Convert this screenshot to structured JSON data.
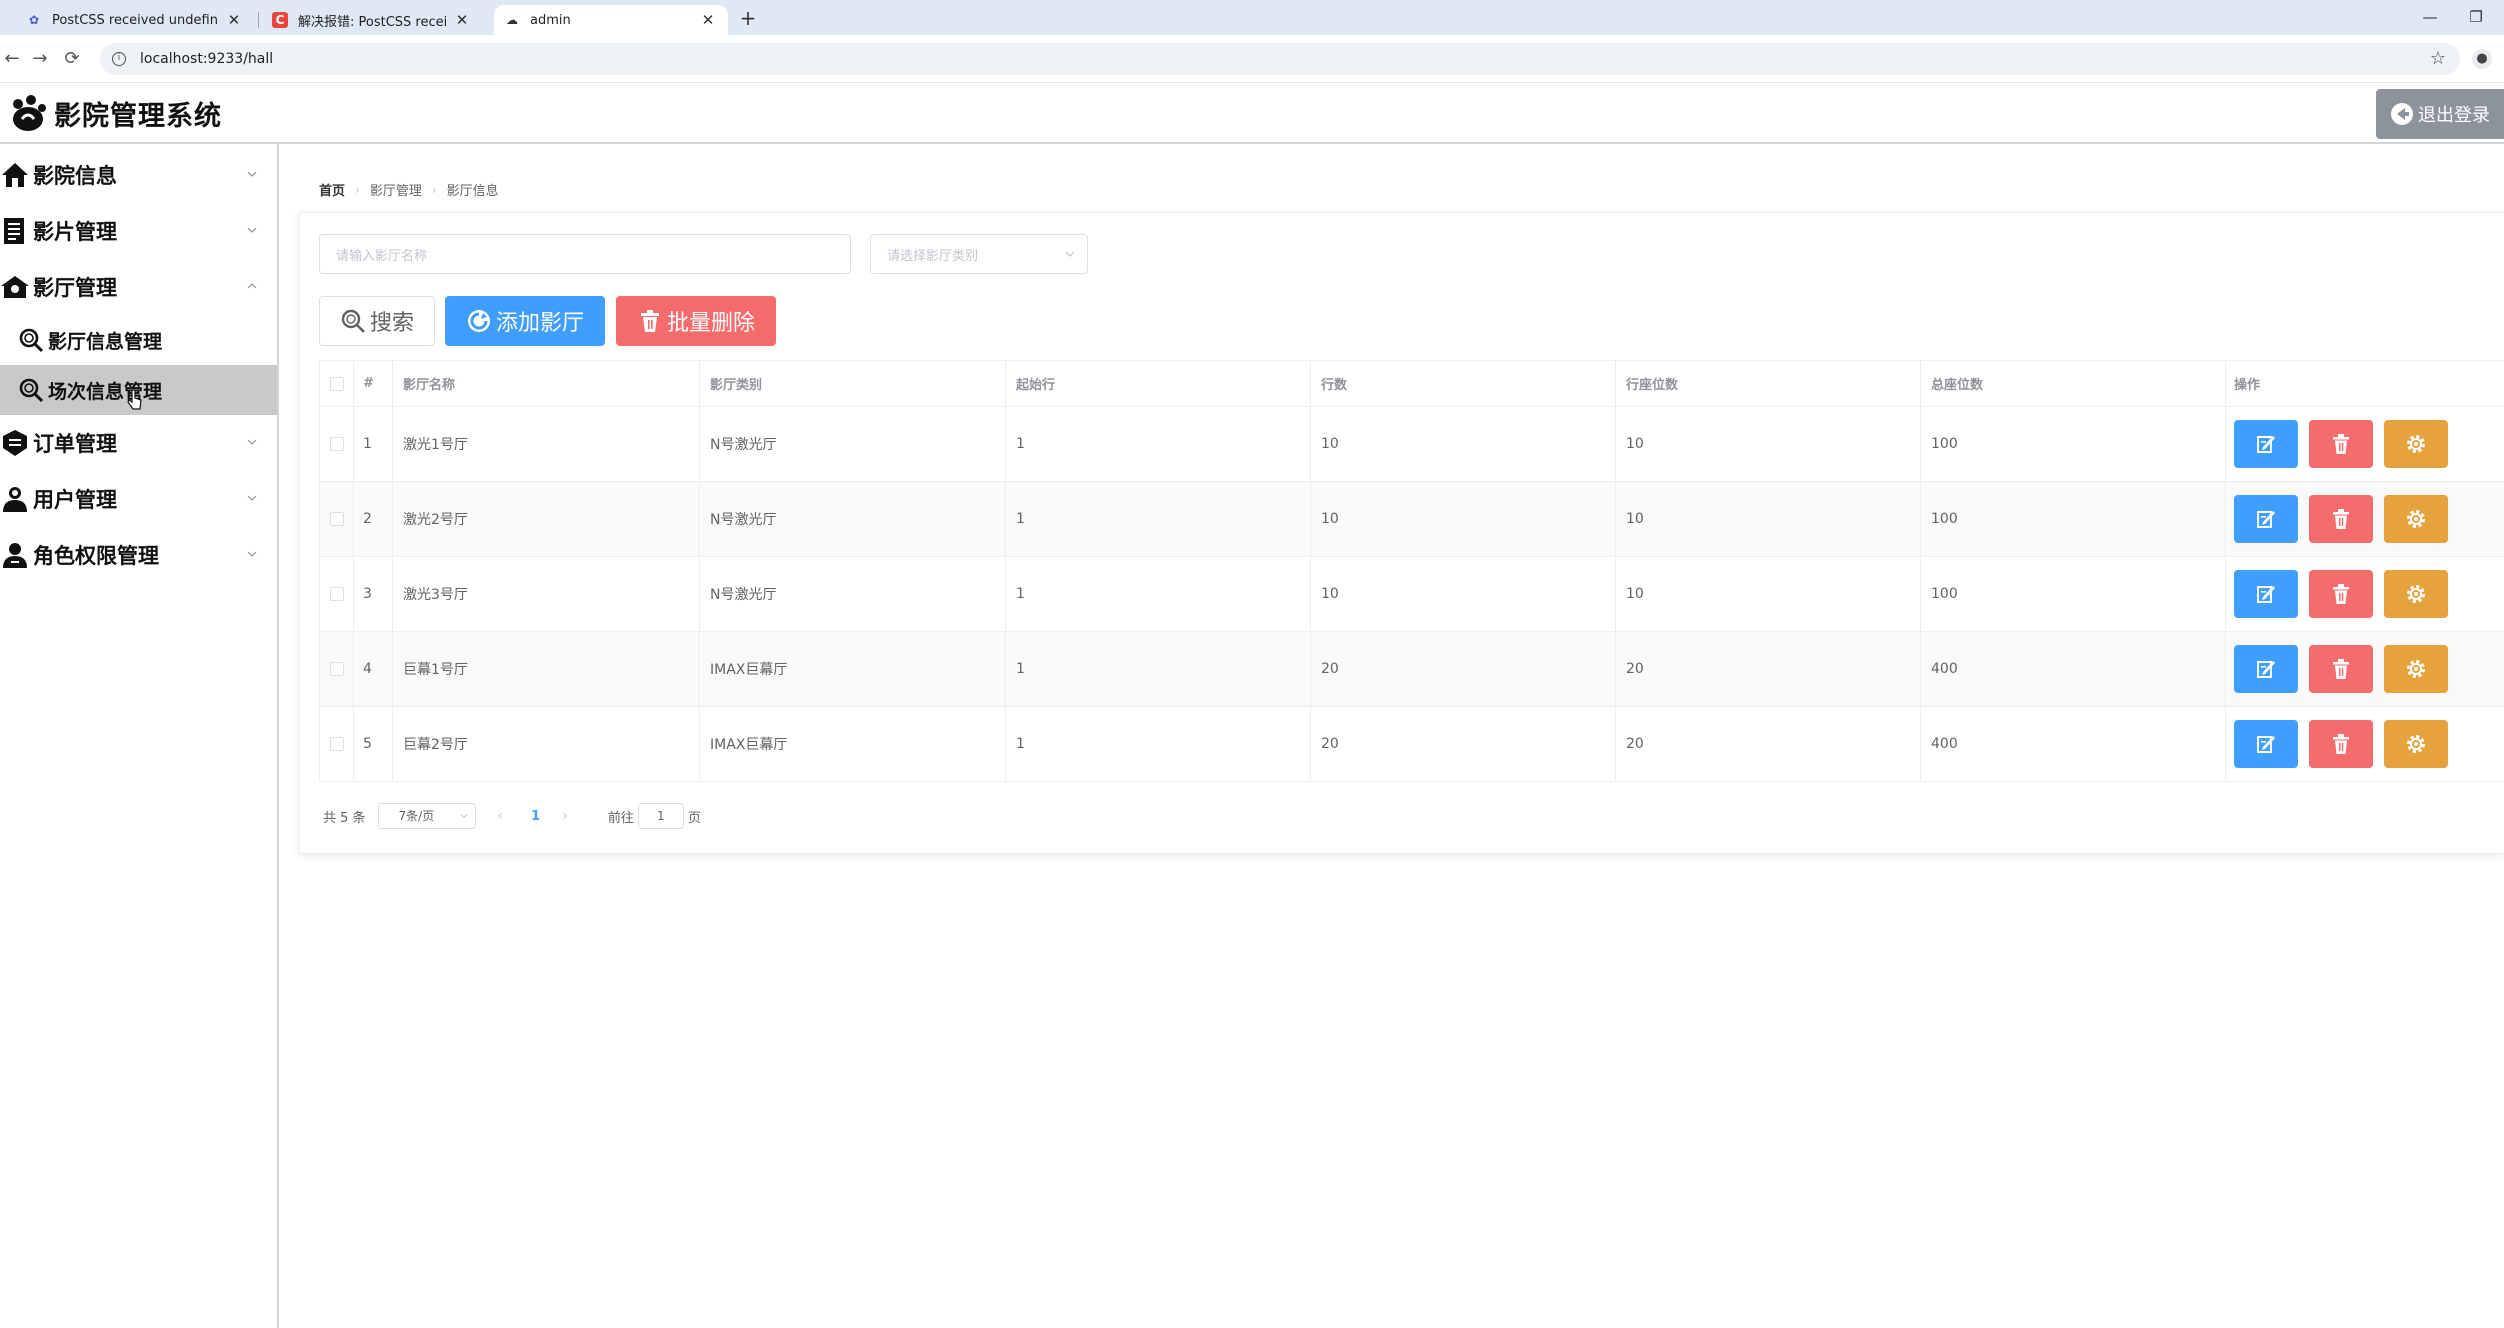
{
  "browser": {
    "tabs": [
      {
        "title": "PostCSS received undefined",
        "icon": "webpack-icon"
      },
      {
        "title": "解决报错: PostCSS received u",
        "icon": "csdn-icon"
      },
      {
        "title": "admin",
        "icon": "app-logo-icon"
      }
    ],
    "new_tab": "+",
    "address": "localhost:9233/hall",
    "back": "←",
    "forward": "→",
    "reload": "⟳",
    "minimize": "—",
    "restore": "❐"
  },
  "header": {
    "app_title": "影院管理系统",
    "logout_label": "退出登录"
  },
  "sidebar": {
    "items": [
      {
        "label": "影院信息",
        "icon": "home-icon",
        "expanded": false
      },
      {
        "label": "影片管理",
        "icon": "document-icon",
        "expanded": false
      },
      {
        "label": "影厅管理",
        "icon": "hall-icon",
        "expanded": true
      },
      {
        "label": "订单管理",
        "icon": "order-icon",
        "expanded": false
      },
      {
        "label": "用户管理",
        "icon": "user-icon",
        "expanded": false
      },
      {
        "label": "角色权限管理",
        "icon": "role-icon",
        "expanded": false
      }
    ],
    "subitems": [
      {
        "label": "影厅信息管理",
        "icon": "search-icon",
        "active": false
      },
      {
        "label": "场次信息管理",
        "icon": "search-icon",
        "active": true
      }
    ]
  },
  "breadcrumb": [
    "首页",
    "影厅管理",
    "影厅信息"
  ],
  "filters": {
    "name_placeholder": "请输入影厅名称",
    "type_placeholder": "请选择影厅类别"
  },
  "buttons": {
    "search": "搜索",
    "add": "添加影厅",
    "batch_delete": "批量删除"
  },
  "table": {
    "columns": [
      "#",
      "影厅名称",
      "影厅类别",
      "起始行",
      "行数",
      "行座位数",
      "总座位数",
      "操作"
    ],
    "rows": [
      {
        "index": "1",
        "name": "激光1号厅",
        "type": "N号激光厅",
        "start_row": "1",
        "rows": "10",
        "seats_per_row": "10",
        "total": "100"
      },
      {
        "index": "2",
        "name": "激光2号厅",
        "type": "N号激光厅",
        "start_row": "1",
        "rows": "10",
        "seats_per_row": "10",
        "total": "100"
      },
      {
        "index": "3",
        "name": "激光3号厅",
        "type": "N号激光厅",
        "start_row": "1",
        "rows": "10",
        "seats_per_row": "10",
        "total": "100"
      },
      {
        "index": "4",
        "name": "巨幕1号厅",
        "type": "IMAX巨幕厅",
        "start_row": "1",
        "rows": "20",
        "seats_per_row": "20",
        "total": "400"
      },
      {
        "index": "5",
        "name": "巨幕2号厅",
        "type": "IMAX巨幕厅",
        "start_row": "1",
        "rows": "20",
        "seats_per_row": "20",
        "total": "400"
      }
    ]
  },
  "pagination": {
    "total_text": "共 5 条",
    "page_size": "7条/页",
    "prev": "‹",
    "current": "1",
    "next": "›",
    "goto_label": "前往",
    "goto_value": "1",
    "page_suffix": "页"
  },
  "colors": {
    "primary": "#409eff",
    "danger": "#f56c6c",
    "warning": "#e6a23c",
    "logout": "#8c939d",
    "active_menu": "#c9c9c9"
  }
}
